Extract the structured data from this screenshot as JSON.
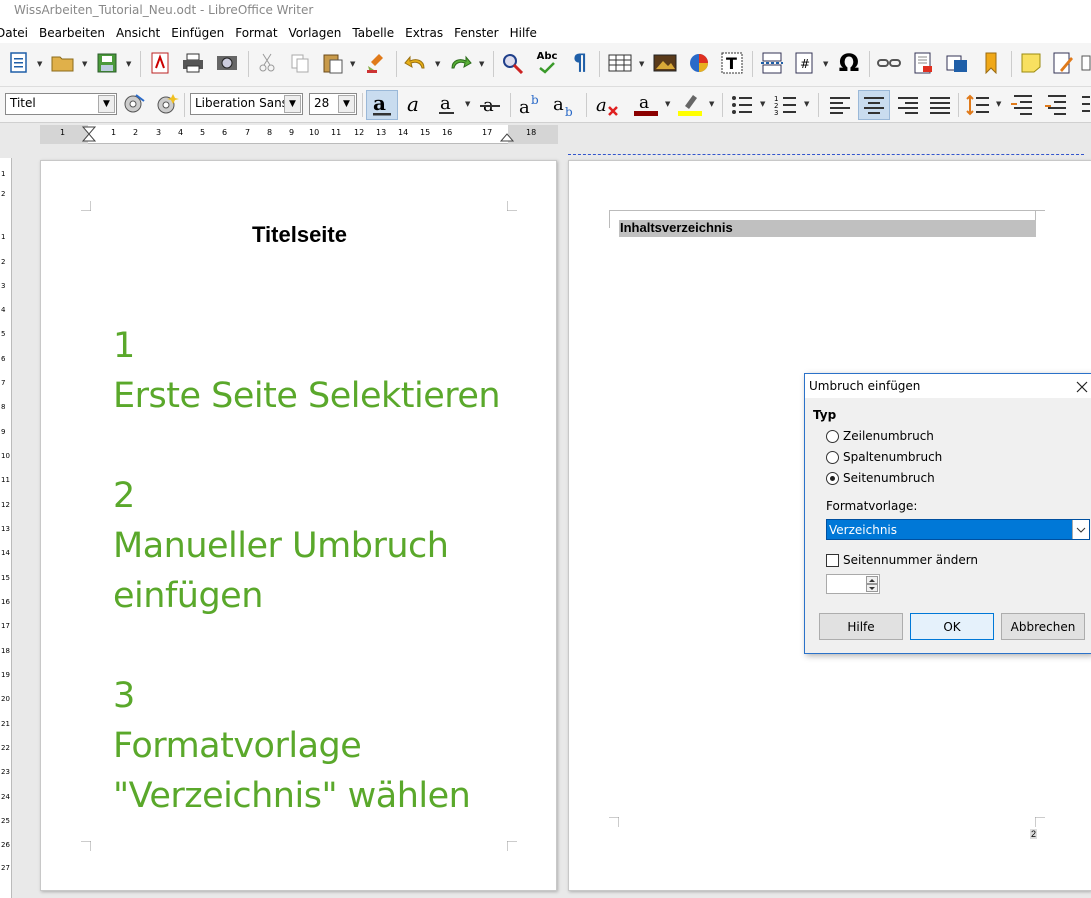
{
  "window": {
    "title": "WissArbeiten_Tutorial_Neu.odt - LibreOffice Writer"
  },
  "menu": [
    "Datei",
    "Bearbeiten",
    "Ansicht",
    "Einfügen",
    "Format",
    "Vorlagen",
    "Tabelle",
    "Extras",
    "Fenster",
    "Hilfe"
  ],
  "formatting": {
    "paragraph_style": "Titel",
    "font_name": "Liberation Sans",
    "font_size": "28",
    "spellcheck_label": "Abc"
  },
  "ruler": {
    "ticks": [
      "1",
      "1",
      "2",
      "3",
      "4",
      "5",
      "6",
      "7",
      "8",
      "9",
      "10",
      "11",
      "12",
      "13",
      "14",
      "15",
      "16",
      "17",
      "18"
    ]
  },
  "ruler_v": {
    "ticks": [
      "1",
      "2",
      "1",
      "2",
      "3",
      "4",
      "5",
      "6",
      "7",
      "8",
      "9",
      "10",
      "11",
      "12",
      "13",
      "14",
      "15",
      "16",
      "17",
      "18",
      "19",
      "20",
      "21",
      "22",
      "23",
      "24",
      "25",
      "26",
      "27"
    ]
  },
  "page1": {
    "title": "Titelseite",
    "steps": [
      {
        "number": "1",
        "text": "Erste Seite Selektieren"
      },
      {
        "number": "2",
        "text": "Manueller Umbruch einfügen"
      },
      {
        "number": "3",
        "text": "Formatvorlage \"Verzeichnis\" wählen"
      }
    ]
  },
  "page2": {
    "heading": "Inhaltsverzeichnis",
    "page_number": "2"
  },
  "dialog": {
    "title": "Umbruch einfügen",
    "type_label": "Typ",
    "options": [
      {
        "label": "Zeilenumbruch",
        "selected": false
      },
      {
        "label": "Spaltenumbruch",
        "selected": false
      },
      {
        "label": "Seitenumbruch",
        "selected": true
      }
    ],
    "style_label": "Formatvorlage:",
    "style_value": "Verzeichnis",
    "change_page_number_label": "Seitennummer ändern",
    "change_page_number_checked": false,
    "page_number_value": "",
    "buttons": {
      "help": "Hilfe",
      "ok": "OK",
      "cancel": "Abbrechen"
    }
  },
  "colors": {
    "accent_green": "#5aa82b",
    "selection_blue": "#0078d7",
    "heading_gray": "#c0c0c0"
  }
}
